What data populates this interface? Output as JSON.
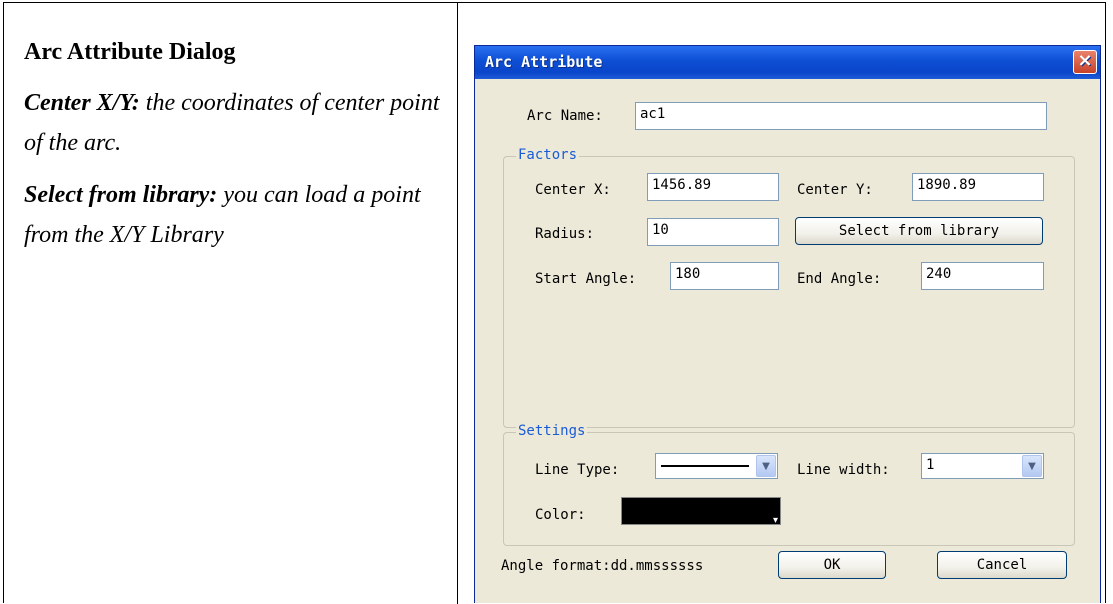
{
  "doc": {
    "heading": "Arc Attribute Dialog",
    "p1_term": "Center X/Y:",
    "p1_text": " the coordinates of center point of the arc.",
    "p2_term": "Select from library:",
    "p2_text": " you can load a point from the X/Y Library"
  },
  "dialog": {
    "title": "Arc Attribute",
    "close": "×",
    "arc_name_label": "Arc Name:",
    "arc_name_value": "ac1",
    "factors_legend": "Factors",
    "center_x_label": "Center X:",
    "center_x_value": "1456.89",
    "center_y_label": "Center Y:",
    "center_y_value": "1890.89",
    "radius_label": "Radius:",
    "radius_value": "10",
    "select_library_label": "Select from library",
    "start_angle_label": "Start Angle:",
    "start_angle_value": "180",
    "end_angle_label": "End Angle:",
    "end_angle_value": "240",
    "settings_legend": "Settings",
    "line_type_label": "Line Type:",
    "line_width_label": "Line width:",
    "line_width_value": "1",
    "color_label": "Color:",
    "color_value": "#000000",
    "angle_format_label": "Angle format:dd.mmssssss",
    "ok_label": "OK",
    "cancel_label": "Cancel"
  }
}
